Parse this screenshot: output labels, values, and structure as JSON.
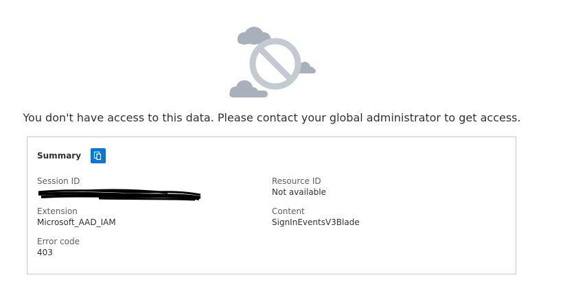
{
  "message": "You don't have access to this data. Please contact your global administrator to get access.",
  "summary": {
    "title": "Summary",
    "copy_icon": "copy-icon",
    "fields": {
      "session_id": {
        "label": "Session ID",
        "value": ""
      },
      "resource_id": {
        "label": "Resource ID",
        "value": "Not available"
      },
      "extension": {
        "label": "Extension",
        "value": "Microsoft_AAD_IAM"
      },
      "content": {
        "label": "Content",
        "value": "SignInEventsV3Blade"
      },
      "error_code": {
        "label": "Error code",
        "value": "403"
      }
    }
  },
  "colors": {
    "accent": "#0078d4",
    "illustration_gray": "#a8b1bb",
    "illustration_light": "#c4cad2"
  }
}
